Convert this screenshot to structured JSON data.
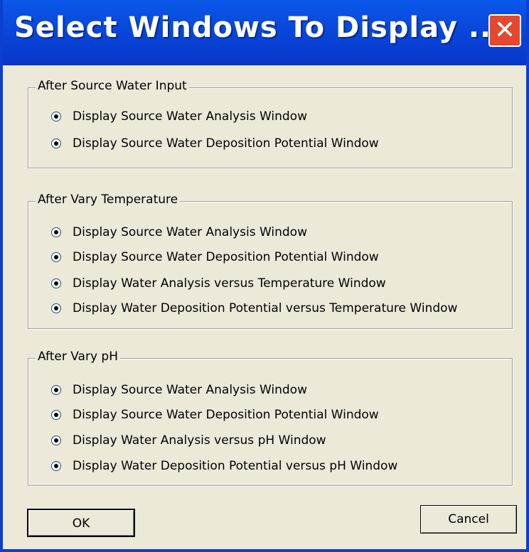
{
  "window": {
    "title": "Select Windows To Display ...",
    "close_glyph": "✕"
  },
  "groups": [
    {
      "label": "After Source Water Input",
      "options": [
        {
          "label": "Display Source Water Analysis Window",
          "checked": true
        },
        {
          "label": "Display Source Water Deposition Potential Window",
          "checked": true
        }
      ]
    },
    {
      "label": "After Vary Temperature",
      "options": [
        {
          "label": "Display Source Water Analysis Window",
          "checked": true
        },
        {
          "label": "Display Source Water Deposition Potential Window",
          "checked": true
        },
        {
          "label": "Display Water Analysis versus Temperature Window",
          "checked": true
        },
        {
          "label": "Display Water Deposition Potential versus Temperature Window",
          "checked": true
        }
      ]
    },
    {
      "label": "After Vary pH",
      "options": [
        {
          "label": "Display Source Water Analysis Window",
          "checked": true
        },
        {
          "label": "Display Source Water Deposition Potential Window",
          "checked": true
        },
        {
          "label": "Display Water Analysis versus pH Window",
          "checked": true
        },
        {
          "label": "Display Water Deposition Potential versus pH Window",
          "checked": true
        }
      ]
    }
  ],
  "buttons": {
    "ok": "OK",
    "cancel": "Cancel"
  },
  "colors": {
    "titlebar": "#0842d6",
    "close": "#e5472f",
    "face": "#ece9d8"
  }
}
